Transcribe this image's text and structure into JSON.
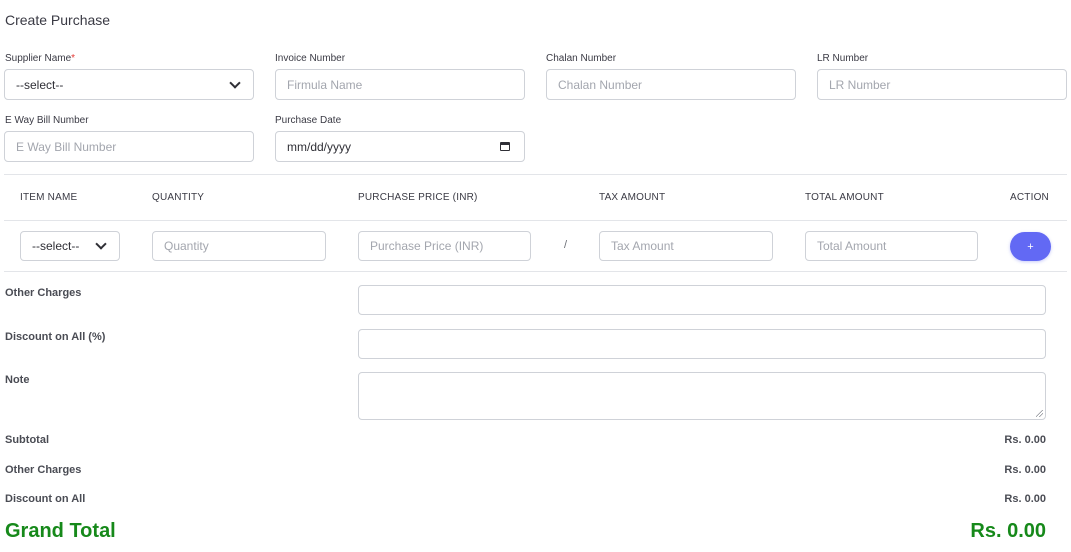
{
  "page": {
    "title": "Create Purchase"
  },
  "form": {
    "supplier": {
      "label": "Supplier Name",
      "required_mark": "*",
      "value": "--select--"
    },
    "invoice": {
      "label": "Invoice Number",
      "placeholder": "Firmula Name"
    },
    "chalan": {
      "label": "Chalan Number",
      "placeholder": "Chalan Number"
    },
    "lr": {
      "label": "LR Number",
      "placeholder": "LR Number"
    },
    "eway": {
      "label": "E Way Bill Number",
      "placeholder": "E Way Bill Number"
    },
    "purchase_date": {
      "label": "Purchase Date",
      "value": "mm/dd/yyyy"
    }
  },
  "items_table": {
    "headers": [
      "ITEM NAME",
      "QUANTITY",
      "PURCHASE PRICE (INR)",
      "TAX AMOUNT",
      "TOTAL AMOUNT",
      "ACTION"
    ],
    "row": {
      "item_value": "--select--",
      "quantity_placeholder": "Quantity",
      "price_placeholder": "Purchase Price (INR)",
      "separator": "/",
      "tax_placeholder": "Tax Amount",
      "total_placeholder": "Total Amount",
      "add_label": "+"
    }
  },
  "extras": {
    "other_charges_label": "Other Charges",
    "discount_label": "Discount on All (%)",
    "note_label": "Note"
  },
  "summary": {
    "subtotal_label": "Subtotal",
    "subtotal_value": "Rs. 0.00",
    "other_charges_label": "Other Charges",
    "other_charges_value": "Rs. 0.00",
    "discount_label": "Discount on All",
    "discount_value": "Rs. 0.00",
    "grand_total_label": "Grand Total",
    "grand_total_value": "Rs. 0.00"
  },
  "colors": {
    "accent": "#6269f4",
    "grand_total": "#16891a",
    "required": "#e53935"
  }
}
